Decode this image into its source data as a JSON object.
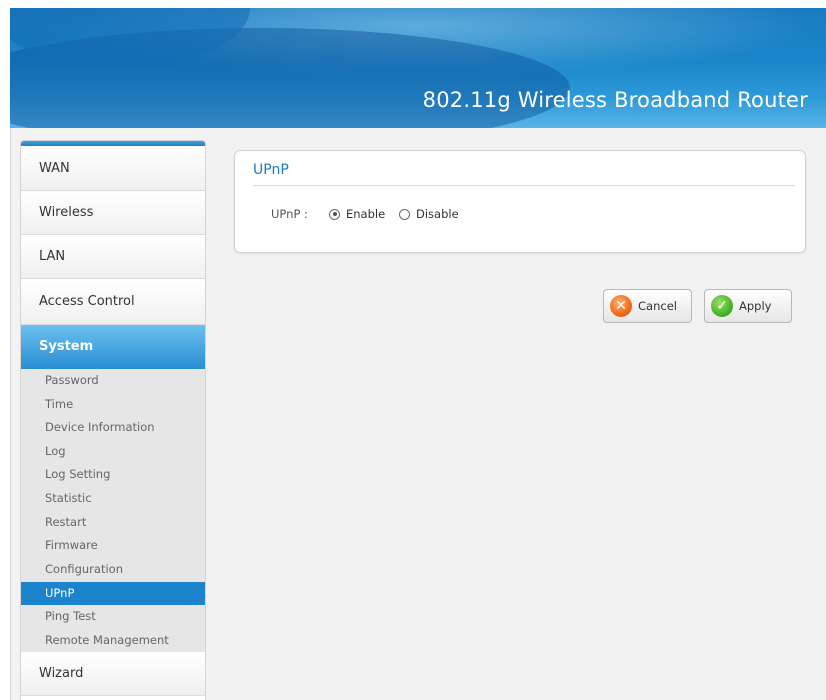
{
  "header": {
    "title": "802.11g Wireless Broadband Router"
  },
  "nav": {
    "items": [
      {
        "label": "WAN"
      },
      {
        "label": "Wireless"
      },
      {
        "label": "LAN"
      },
      {
        "label": "Access Control"
      },
      {
        "label": "System",
        "active": true
      },
      {
        "label": "Wizard"
      }
    ],
    "system_submenu": [
      {
        "label": "Password"
      },
      {
        "label": "Time"
      },
      {
        "label": "Device Information"
      },
      {
        "label": "Log"
      },
      {
        "label": "Log Setting"
      },
      {
        "label": "Statistic"
      },
      {
        "label": "Restart"
      },
      {
        "label": "Firmware"
      },
      {
        "label": "Configuration"
      },
      {
        "label": "UPnP",
        "active": true
      },
      {
        "label": "Ping Test"
      },
      {
        "label": "Remote Management"
      }
    ]
  },
  "upnp_panel": {
    "title": "UPnP",
    "field_label": "UPnP :",
    "options": [
      {
        "label": "Enable",
        "checked": true
      },
      {
        "label": "Disable",
        "checked": false
      }
    ]
  },
  "buttons": {
    "cancel_label": "Cancel",
    "apply_label": "Apply"
  },
  "icons": {
    "cancel": "cancel-x-icon",
    "apply": "apply-check-icon"
  },
  "colors": {
    "accent": "#1a7cc2",
    "active_nav": "#2a8fd4",
    "active_sub": "#1b84cc"
  }
}
